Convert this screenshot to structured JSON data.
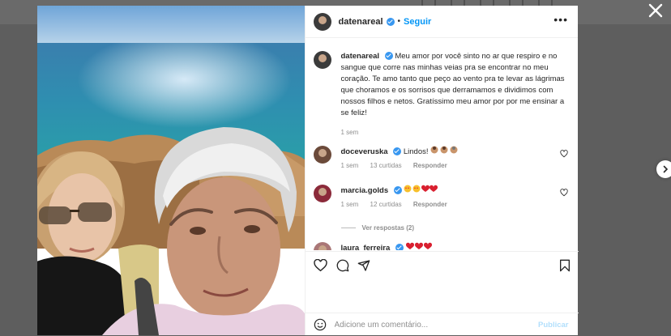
{
  "post": {
    "username": "datenareal",
    "follow_label": "Seguir",
    "dot": "•",
    "more_label": "•••",
    "caption": "Meu amor por você sinto no ar que respiro e no sangue que corre nas minhas veias pra se encontrar no meu coração. Te amo tanto que peço ao vento pra te levar as lágrimas que choramos e os sorrisos que derramamos e dividimos com nossos filhos e netos. Gratíssimo meu amor por por me ensinar a se feliz!",
    "caption_time": "1 sem"
  },
  "comments": [
    {
      "username": "doceveruska",
      "text": "Lindos!",
      "time": "1 sem",
      "likes": "13 curtidas",
      "reply": "Responder"
    },
    {
      "username": "marcia.golds",
      "text": "",
      "time": "1 sem",
      "likes": "12 curtidas",
      "reply": "Responder"
    },
    {
      "username": "laura_ferreira",
      "text": ""
    }
  ],
  "view_replies": "Ver respostas (2)",
  "add_comment": {
    "placeholder": "Adicione um comentário...",
    "publish_label": "Publicar"
  },
  "icons": {
    "close": "close-icon",
    "next": "chevron-right-icon",
    "more": "more-options-icon",
    "like": "heart-icon",
    "comment": "comment-icon",
    "share": "share-icon",
    "save": "bookmark-icon",
    "emoji": "emoji-icon"
  },
  "colors": {
    "accent": "#0095f6",
    "verified": "#3897f0",
    "publish_disabled": "#b2dffc",
    "heart_red": "#ed4956"
  }
}
